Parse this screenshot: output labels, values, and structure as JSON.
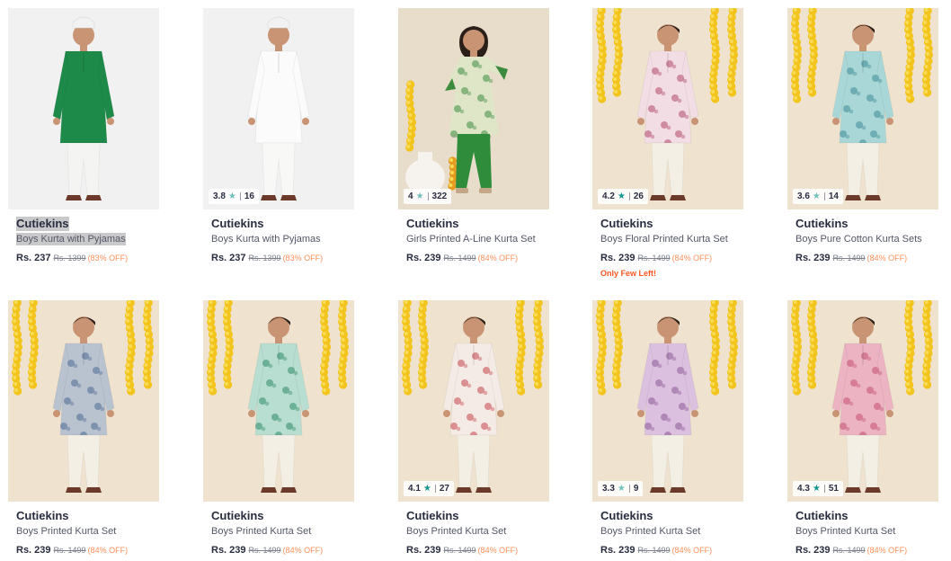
{
  "products": [
    {
      "brand": "Cutiekins",
      "name": "Boys Kurta with Pyjamas",
      "price": "Rs. 237",
      "mrp": "Rs. 1399",
      "discount": "(83% OFF)",
      "rating": "",
      "rating_count": "",
      "tag": "",
      "bg": "#f1f1f1",
      "kurta": "#1e8a4a",
      "pattern": "#1e8a4a",
      "pants": "#f4f4f2",
      "cap": true,
      "girl": false
    },
    {
      "brand": "Cutiekins",
      "name": "Boys Kurta with Pyjamas",
      "price": "Rs. 237",
      "mrp": "Rs. 1399",
      "discount": "(83% OFF)",
      "rating": "3.8",
      "rating_count": "16",
      "star_color": "#72bfbc",
      "tag": "",
      "bg": "#f1f1f1",
      "kurta": "#fbfbfb",
      "pattern": "#fbfbfb",
      "pants": "#f8f8f6",
      "cap": true,
      "girl": false
    },
    {
      "brand": "Cutiekins",
      "name": "Girls Printed A-Line Kurta Set",
      "price": "Rs. 239",
      "mrp": "Rs. 1499",
      "discount": "(84% OFF)",
      "rating": "4",
      "rating_count": "322",
      "star_color": "#72bfbc",
      "tag": "",
      "bg": "#e8dccb",
      "kurta": "#dfe6c8",
      "pattern": "#3b8a3e",
      "pants": "#2f8c3a",
      "cap": false,
      "girl": true
    },
    {
      "brand": "Cutiekins",
      "name": "Boys Floral Printed Kurta Set",
      "price": "Rs. 239",
      "mrp": "Rs. 1499",
      "discount": "(84% OFF)",
      "rating": "4.2",
      "rating_count": "26",
      "star_color": "#14958f",
      "tag": "Only Few Left!",
      "bg": "#efe3cf",
      "kurta": "#f1dde3",
      "pattern": "#b2476a",
      "pants": "#f3efe4",
      "cap": false,
      "girl": false
    },
    {
      "brand": "Cutiekins",
      "name": "Boys Pure Cotton Kurta Sets",
      "price": "Rs. 239",
      "mrp": "Rs. 1499",
      "discount": "(84% OFF)",
      "rating": "3.6",
      "rating_count": "14",
      "star_color": "#72bfbc",
      "tag": "",
      "bg": "#efe3cf",
      "kurta": "#a9d6d6",
      "pattern": "#3c8c97",
      "pants": "#f3efe4",
      "cap": false,
      "girl": false
    },
    {
      "brand": "Cutiekins",
      "name": "Boys Printed Kurta Set",
      "price": "Rs. 239",
      "mrp": "Rs. 1499",
      "discount": "(84% OFF)",
      "rating": "",
      "rating_count": "",
      "tag": "",
      "bg": "#efe3cf",
      "kurta": "#b9c2cf",
      "pattern": "#4d6c93",
      "pants": "#f3efe4",
      "cap": false,
      "girl": false
    },
    {
      "brand": "Cutiekins",
      "name": "Boys Printed Kurta Set",
      "price": "Rs. 239",
      "mrp": "Rs. 1499",
      "discount": "(84% OFF)",
      "rating": "",
      "rating_count": "",
      "tag": "",
      "bg": "#efe3cf",
      "kurta": "#b7ded0",
      "pattern": "#2f8a6a",
      "pants": "#f3efe4",
      "cap": false,
      "girl": false
    },
    {
      "brand": "Cutiekins",
      "name": "Boys Printed Kurta Set",
      "price": "Rs. 239",
      "mrp": "Rs. 1499",
      "discount": "(84% OFF)",
      "rating": "4.1",
      "rating_count": "27",
      "star_color": "#14958f",
      "tag": "",
      "bg": "#efe3cf",
      "kurta": "#f5ebe6",
      "pattern": "#c5434b",
      "pants": "#f3efe4",
      "cap": false,
      "girl": false
    },
    {
      "brand": "Cutiekins",
      "name": "Boys Printed Kurta Set",
      "price": "Rs. 239",
      "mrp": "Rs. 1499",
      "discount": "(84% OFF)",
      "rating": "3.3",
      "rating_count": "9",
      "star_color": "#72bfbc",
      "tag": "",
      "bg": "#efe3cf",
      "kurta": "#dcc0df",
      "pattern": "#8c5a96",
      "pants": "#f3efe4",
      "cap": false,
      "girl": false
    },
    {
      "brand": "Cutiekins",
      "name": "Boys Printed Kurta Set",
      "price": "Rs. 239",
      "mrp": "Rs. 1499",
      "discount": "(84% OFF)",
      "rating": "4.3",
      "rating_count": "51",
      "star_color": "#14958f",
      "tag": "",
      "bg": "#efe3cf",
      "kurta": "#ecb3c3",
      "pattern": "#c44f71",
      "pants": "#f3efe4",
      "cap": false,
      "girl": false
    }
  ],
  "star_glyph": "★",
  "colors": {
    "brand_text": "#282c3f",
    "discount": "#ff905a",
    "few_left": "#ff5722",
    "marigold": "#f2c41d",
    "skin": "#c99474",
    "hair": "#2b2019"
  }
}
